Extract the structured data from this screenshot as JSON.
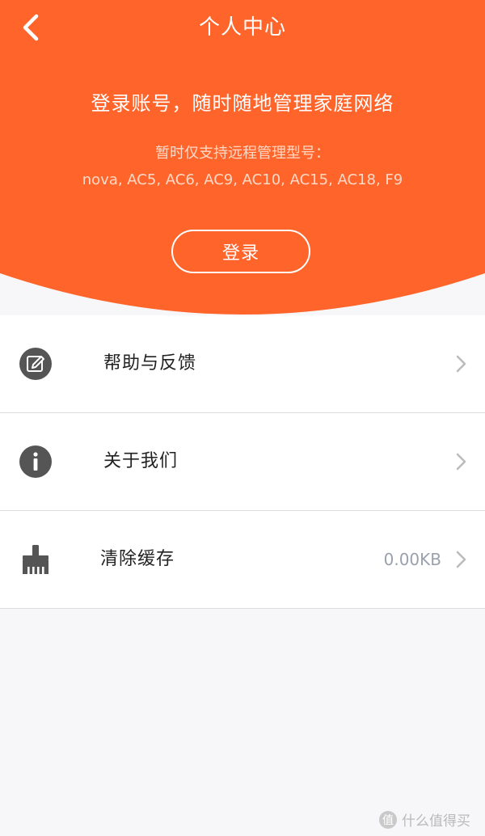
{
  "nav": {
    "back_icon": "chevron-left-icon",
    "title": "个人中心"
  },
  "hero": {
    "headline": "登录账号，随时随地管理家庭网络",
    "support_note": "暂时仅支持远程管理型号：",
    "support_models": "nova, AC5, AC6, AC9, AC10, AC15, AC18, F9",
    "login_label": "登录"
  },
  "menu": {
    "items": [
      {
        "label": "帮助与反馈",
        "icon": "edit-note-icon",
        "value": ""
      },
      {
        "label": "关于我们",
        "icon": "info-icon",
        "value": ""
      },
      {
        "label": "清除缓存",
        "icon": "broom-icon",
        "value": "0.00KB"
      }
    ]
  },
  "watermark": {
    "icon_char": "值",
    "text": "什么值得买"
  },
  "colors": {
    "accent": "#ff642b",
    "icon_gray": "#555555",
    "chevron": "#bbbbbb",
    "value_gray": "#9aa1ad"
  }
}
